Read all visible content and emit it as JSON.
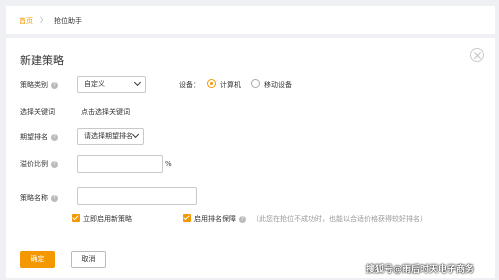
{
  "breadcrumb": {
    "home": "首页",
    "separator": "〉",
    "current": "抢位助手"
  },
  "panel": {
    "title": "新建策略"
  },
  "form": {
    "strategy_type_label": "策略类别",
    "strategy_type_value": "自定义",
    "device_label": "设备：",
    "device_options": [
      "计算机",
      "移动设备"
    ],
    "device_selected": "计算机",
    "keyword_label": "选择关键词",
    "keyword_link": "点击选择关键词",
    "rank_label": "期望排名",
    "rank_value": "请选择期望排名",
    "ratio_label": "溢价比例",
    "ratio_unit": "%",
    "name_label": "策略名称",
    "enable_label": "立即启用新策略",
    "protect_label": "启用排名保障",
    "protect_hint": "（此您在抢位不成功时，也能以合适价格获得较好排名）"
  },
  "buttons": {
    "ok": "确定",
    "cancel": "取消"
  },
  "watermark": "搜狐号@雨后时天电子商务",
  "colors": {
    "accent": "#f39800"
  }
}
